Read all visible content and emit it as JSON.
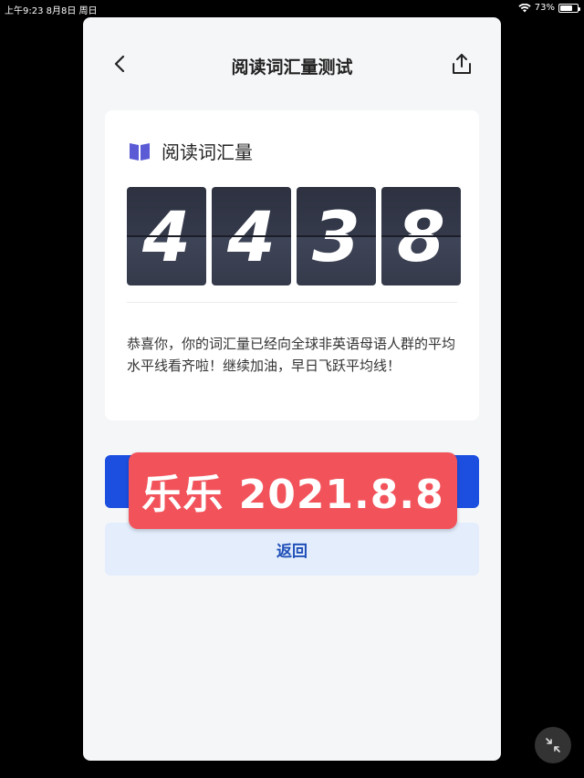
{
  "status_bar": {
    "time": "上午9:23  8月8日 周日",
    "battery": "73%",
    "battery_level": 0.73
  },
  "nav": {
    "title": "阅读词汇量测试",
    "back_icon": "chevron-left-icon",
    "share_icon": "share-icon"
  },
  "card": {
    "icon": "book-icon",
    "icon_color": "#5b5bd6",
    "title": "阅读词汇量",
    "digits": [
      "4",
      "4",
      "3",
      "8"
    ],
    "message": "恭喜你，你的词汇量已经向全球非英语母语人群的平均水平线看齐啦！继续加油，早日飞跃平均线！"
  },
  "buttons": {
    "return_label": "返回",
    "primary_color": "#1c4fe0"
  },
  "stamp": {
    "text": "乐乐 2021.8.8",
    "color": "#f2535b"
  },
  "floating": {
    "icon": "collapse-icon"
  }
}
